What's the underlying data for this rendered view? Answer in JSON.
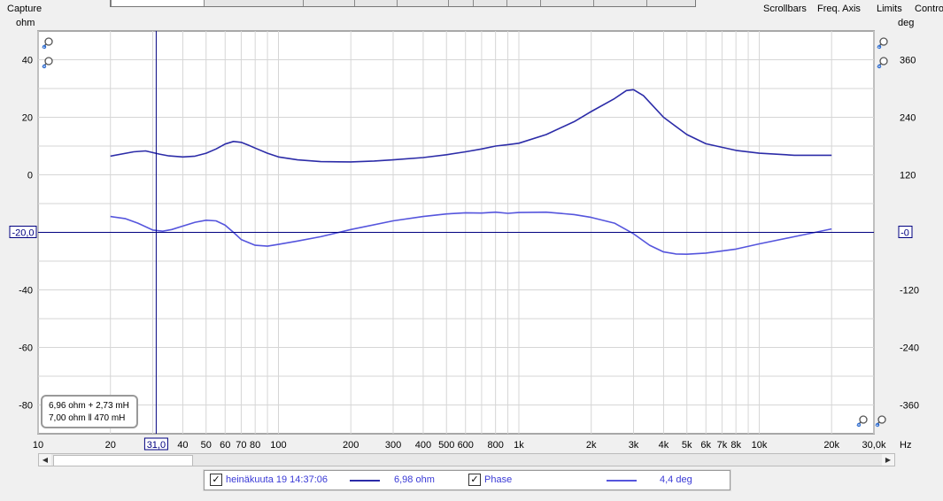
{
  "top_toolbar": {
    "capture_label": "Capture",
    "scrollbars_label": "Scrollbars",
    "freq_axis_label": "Freq. Axis",
    "limits_label": "Limits",
    "controls_label": "Contro"
  },
  "units": {
    "left": "ohm",
    "right": "deg"
  },
  "readout": {
    "line1": "6,96 ohm + 2,73 mH",
    "line2": "7,00 ohm ‖ 470 mH"
  },
  "cursor": {
    "x_label": "31,0",
    "y_label_left": "-20,0",
    "y_label_right": "-0",
    "freq": 31,
    "ohm": -20
  },
  "legend": {
    "trace_name": "heinäkuuta 19 14:37:06",
    "trace_value": "6,98 ohm",
    "phase_label": "Phase",
    "phase_value": "4,4 deg",
    "colors": {
      "impedance": "#2c2ca8",
      "phase": "#5555dd"
    }
  },
  "chart_data": {
    "type": "line",
    "x_scale": "log",
    "xlim": [
      10,
      30000
    ],
    "ylim_left": [
      -90,
      50
    ],
    "ylim_right": [
      -420,
      420
    ],
    "x_ticks": [
      {
        "v": 10,
        "label": "10"
      },
      {
        "v": 20,
        "label": "20"
      },
      {
        "v": 40,
        "label": "40"
      },
      {
        "v": 50,
        "label": "50"
      },
      {
        "v": 60,
        "label": "60"
      },
      {
        "v": 70,
        "label": "70"
      },
      {
        "v": 80,
        "label": "80"
      },
      {
        "v": 100,
        "label": "100"
      },
      {
        "v": 200,
        "label": "200"
      },
      {
        "v": 300,
        "label": "300"
      },
      {
        "v": 400,
        "label": "400"
      },
      {
        "v": 500,
        "label": "500"
      },
      {
        "v": 600,
        "label": "600"
      },
      {
        "v": 800,
        "label": "800"
      },
      {
        "v": 1000,
        "label": "1k"
      },
      {
        "v": 2000,
        "label": "2k"
      },
      {
        "v": 3000,
        "label": "3k"
      },
      {
        "v": 4000,
        "label": "4k"
      },
      {
        "v": 5000,
        "label": "5k"
      },
      {
        "v": 6000,
        "label": "6k"
      },
      {
        "v": 7000,
        "label": "7k"
      },
      {
        "v": 8000,
        "label": "8k"
      },
      {
        "v": 10000,
        "label": "10k"
      },
      {
        "v": 20000,
        "label": "20k"
      },
      {
        "v": 30000,
        "label": "30,0k"
      }
    ],
    "x_unit": "Hz",
    "y_left_ticks": [
      40,
      20,
      0,
      -40,
      -60,
      -80
    ],
    "y_right_ticks": [
      360,
      240,
      120,
      -120,
      -240,
      -360
    ],
    "grid": true,
    "series": [
      {
        "axis": "left",
        "x": [
          20,
          25,
          28,
          32,
          35,
          40,
          45,
          50,
          55,
          60,
          65,
          70,
          75,
          80,
          90,
          100,
          120,
          150,
          200,
          250,
          300,
          400,
          500,
          600,
          700,
          800,
          900,
          1000,
          1300,
          1700,
          2000,
          2500,
          2800,
          3000,
          3300,
          4000,
          5000,
          6000,
          8000,
          10000,
          14000,
          20000
        ],
        "values": [
          6.5,
          8,
          8.3,
          7.2,
          6.6,
          6.2,
          6.5,
          7.5,
          9,
          10.7,
          11.6,
          11.3,
          10.3,
          9.3,
          7.5,
          6.2,
          5.2,
          4.6,
          4.5,
          4.8,
          5.2,
          6,
          7,
          8,
          9,
          10,
          10.5,
          11,
          14,
          18.5,
          22,
          26.5,
          29.3,
          29.6,
          27.5,
          20,
          14,
          10.8,
          8.5,
          7.5,
          6.8,
          6.8
        ]
      },
      {
        "axis": "left",
        "x": [
          20,
          23,
          26,
          30,
          33,
          36,
          40,
          45,
          50,
          55,
          60,
          65,
          70,
          80,
          90,
          100,
          120,
          150,
          200,
          300,
          400,
          500,
          600,
          700,
          800,
          900,
          1000,
          1300,
          1700,
          2000,
          2500,
          3000,
          3500,
          4000,
          4500,
          5000,
          6000,
          8000,
          10000,
          14000,
          20000
        ],
        "values": [
          -14.5,
          -15.2,
          -16.8,
          -19.2,
          -19.6,
          -19,
          -17.8,
          -16.5,
          -15.8,
          -16,
          -17.5,
          -20,
          -22.5,
          -24.5,
          -24.8,
          -24.2,
          -23,
          -21.5,
          -19,
          -16,
          -14.5,
          -13.6,
          -13.2,
          -13.3,
          -13,
          -13.4,
          -13.1,
          -13,
          -13.8,
          -14.8,
          -16.8,
          -20.5,
          -24.5,
          -26.8,
          -27.5,
          -27.6,
          -27.2,
          -25.8,
          -24,
          -21.5,
          -18.8
        ]
      }
    ]
  }
}
